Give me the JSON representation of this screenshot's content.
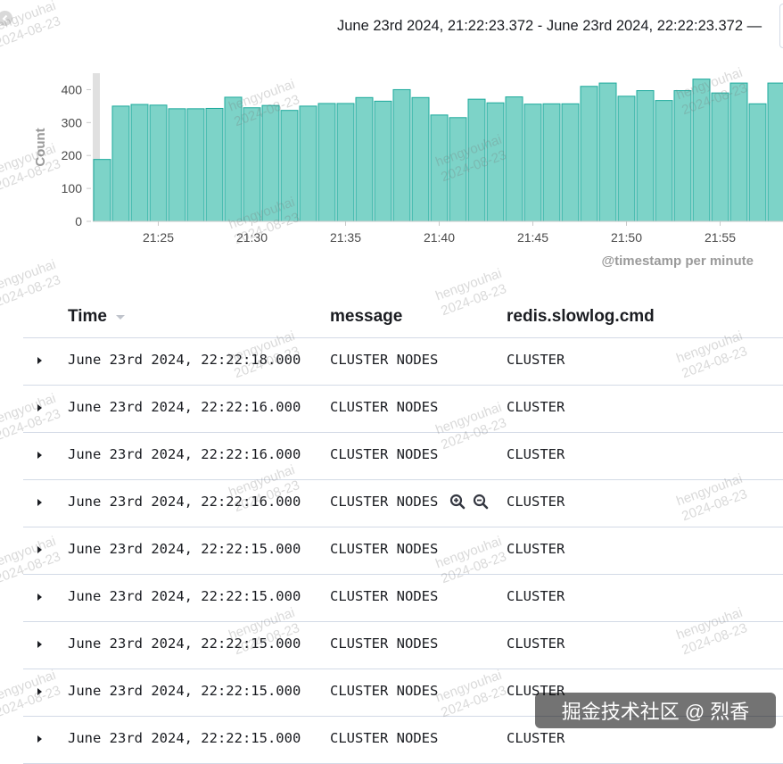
{
  "time_range": "June 23rd 2024, 21:22:23.372 - June 23rd 2024, 22:22:23.372 —",
  "icons": {
    "back": "circle-chevron-left-icon",
    "sort": "sort-down-icon",
    "expand": "caret-right-icon",
    "filter_for": "magnify-plus-icon",
    "filter_out": "magnify-minus-icon"
  },
  "colors": {
    "bar_fill": "#7dd3c8",
    "bar_stroke": "#1ba99b",
    "axis_text": "#4a4a4a",
    "divider": "#d3dae6"
  },
  "chart_data": {
    "type": "bar",
    "ylabel": "Count",
    "xlabel": "@timestamp per minute",
    "ylim": [
      0,
      450
    ],
    "yticks": [
      0,
      100,
      200,
      300,
      400
    ],
    "xtick_labels": [
      "21:25",
      "21:30",
      "21:35",
      "21:40",
      "21:45",
      "21:50",
      "21:55"
    ],
    "xtick_index": [
      3,
      8,
      13,
      18,
      23,
      28,
      33
    ],
    "values": [
      188,
      350,
      355,
      353,
      342,
      342,
      343,
      377,
      345,
      352,
      337,
      350,
      358,
      358,
      376,
      365,
      400,
      376,
      323,
      315,
      371,
      360,
      378,
      356,
      357,
      357,
      410,
      420,
      380,
      397,
      367,
      397,
      432,
      390,
      420,
      357,
      420
    ]
  },
  "table": {
    "columns": {
      "time": "Time",
      "message": "message",
      "cmd": "redis.slowlog.cmd"
    },
    "rows": [
      {
        "time": "June 23rd 2024, 22:22:18.000",
        "message": "CLUSTER NODES",
        "cmd": "CLUSTER"
      },
      {
        "time": "June 23rd 2024, 22:22:16.000",
        "message": "CLUSTER NODES",
        "cmd": "CLUSTER"
      },
      {
        "time": "June 23rd 2024, 22:22:16.000",
        "message": "CLUSTER NODES",
        "cmd": "CLUSTER"
      },
      {
        "time": "June 23rd 2024, 22:22:16.000",
        "message": "CLUSTER NODES",
        "cmd": "CLUSTER"
      },
      {
        "time": "June 23rd 2024, 22:22:15.000",
        "message": "CLUSTER NODES",
        "cmd": "CLUSTER"
      },
      {
        "time": "June 23rd 2024, 22:22:15.000",
        "message": "CLUSTER NODES",
        "cmd": "CLUSTER"
      },
      {
        "time": "June 23rd 2024, 22:22:15.000",
        "message": "CLUSTER NODES",
        "cmd": "CLUSTER"
      },
      {
        "time": "June 23rd 2024, 22:22:15.000",
        "message": "CLUSTER NODES",
        "cmd": "CLUSTER"
      },
      {
        "time": "June 23rd 2024, 22:22:15.000",
        "message": "CLUSTER NODES",
        "cmd": "CLUSTER"
      }
    ]
  },
  "watermark": {
    "user": "hengyouhai",
    "date": "2024-08-23"
  },
  "badge": "掘金技术社区 @ 烈香"
}
